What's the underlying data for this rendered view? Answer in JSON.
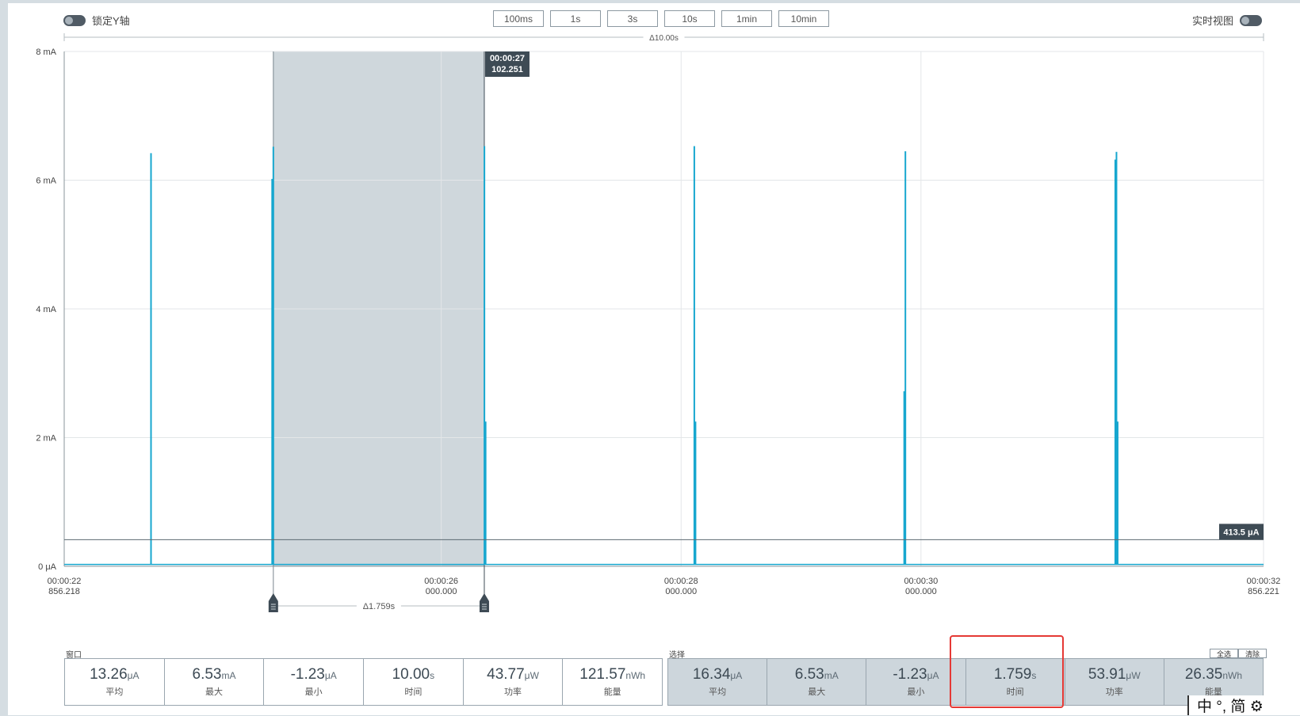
{
  "top_bar": {
    "lock_y_label": "锁定Y轴",
    "live_view_label": "实时视图",
    "zoom_buttons": [
      "100ms",
      "1s",
      "3s",
      "10s",
      "1min",
      "10min"
    ]
  },
  "window_delta": "Δ10.00s",
  "selection_delta": "Δ1.759s",
  "cursor_tooltip": {
    "time": "00:00:27",
    "value": "102.251"
  },
  "level_label": "413.5 μA",
  "chart_data": {
    "type": "line",
    "ylabel": "",
    "y_unit": "mA",
    "ylim": [
      0,
      8
    ],
    "y_ticks": [
      "0 μA",
      "2 mA",
      "4 mA",
      "6 mA",
      "8 mA"
    ],
    "x_seconds": [
      22.856218,
      32.856221
    ],
    "x_ticks": [
      {
        "t": 22.856218,
        "time": "00:00:22",
        "sub": "856.218"
      },
      {
        "t": 26.0,
        "time": "00:00:26",
        "sub": "000.000"
      },
      {
        "t": 28.0,
        "time": "00:00:28",
        "sub": "000.000"
      },
      {
        "t": 30.0,
        "time": "00:00:30",
        "sub": "000.000"
      },
      {
        "t": 32.856221,
        "time": "00:00:32",
        "sub": "856.221"
      }
    ],
    "selection": {
      "start_s": 24.6,
      "end_s": 26.359
    },
    "baseline_mA": 0.03,
    "spikes": [
      {
        "t": 23.58,
        "peak_mA": 6.42
      },
      {
        "t": 24.59,
        "peak_mA": 6.02
      },
      {
        "t": 24.6,
        "peak_mA": 6.52
      },
      {
        "t": 26.36,
        "peak_mA": 6.53
      },
      {
        "t": 26.37,
        "peak_mA": 2.25
      },
      {
        "t": 28.11,
        "peak_mA": 6.53
      },
      {
        "t": 28.12,
        "peak_mA": 2.25
      },
      {
        "t": 29.87,
        "peak_mA": 6.45
      },
      {
        "t": 29.86,
        "peak_mA": 2.72
      },
      {
        "t": 31.62,
        "peak_mA": 6.32
      },
      {
        "t": 31.63,
        "peak_mA": 6.44
      },
      {
        "t": 31.64,
        "peak_mA": 2.25
      }
    ],
    "level_mA": 0.4135,
    "colors": {
      "line": "#17a7cf",
      "selection": "#cfd7dc",
      "grid": "#e3e6e8",
      "axis": "#8a949b",
      "tooltip": "#3e4b55"
    }
  },
  "window_panel": {
    "title": "窗口",
    "stats": [
      {
        "value": "13.26",
        "unit": "μA",
        "label": "平均"
      },
      {
        "value": "6.53",
        "unit": "mA",
        "label": "最大"
      },
      {
        "value": "-1.23",
        "unit": "μA",
        "label": "最小"
      },
      {
        "value": "10.00",
        "unit": "s",
        "label": "时间"
      },
      {
        "value": "43.77",
        "unit": "μW",
        "label": "功率"
      },
      {
        "value": "121.57",
        "unit": "nWh",
        "label": "能量"
      }
    ]
  },
  "selection_panel": {
    "title": "选择",
    "select_all": "全选",
    "clear": "清除",
    "stats": [
      {
        "value": "16.34",
        "unit": "μA",
        "label": "平均"
      },
      {
        "value": "6.53",
        "unit": "mA",
        "label": "最大"
      },
      {
        "value": "-1.23",
        "unit": "μA",
        "label": "最小"
      },
      {
        "value": "1.759",
        "unit": "s",
        "label": "时间"
      },
      {
        "value": "53.91",
        "unit": "μW",
        "label": "功率"
      },
      {
        "value": "26.35",
        "unit": "nWh",
        "label": "能量"
      }
    ]
  },
  "ime_bar": {
    "text": "中 °, 简 ⚙"
  }
}
